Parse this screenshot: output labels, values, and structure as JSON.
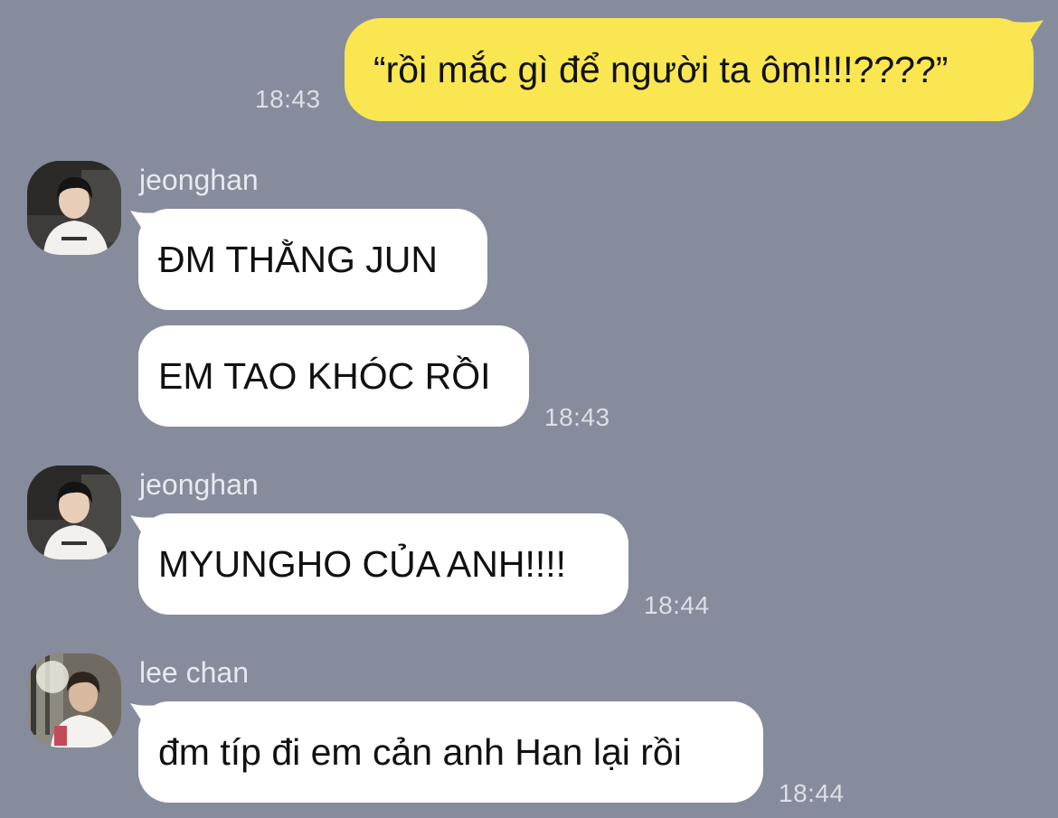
{
  "messages": [
    {
      "id": "m1",
      "direction": "outgoing",
      "text": "“rồi mắc gì để người ta ôm!!!!????”",
      "time": "18:43"
    },
    {
      "id": "m2",
      "direction": "incoming",
      "sender": "jeonghan",
      "text": "ĐM THẰNG JUN"
    },
    {
      "id": "m3",
      "direction": "incoming",
      "sender": "jeonghan",
      "text": "EM TAO KHÓC RỒI",
      "time": "18:43"
    },
    {
      "id": "m4",
      "direction": "incoming",
      "sender": "jeonghan",
      "text": "MYUNGHO CỦA ANH!!!!",
      "time": "18:44"
    },
    {
      "id": "m5",
      "direction": "incoming",
      "sender": "lee chan",
      "text": "đm típ đi em cản anh Han lại rồi",
      "time": "18:44"
    }
  ],
  "groups": [
    {
      "sender": "jeonghan",
      "avatar": "profile-photo"
    },
    {
      "sender": "jeonghan",
      "avatar": "profile-photo"
    },
    {
      "sender": "lee chan",
      "avatar": "profile-photo"
    }
  ],
  "colors": {
    "background": "#868c9c",
    "outgoing_bubble": "#f9e651",
    "incoming_bubble": "#ffffff",
    "timestamp": "#dcdfe6",
    "sender_name": "#e7e9ef"
  }
}
